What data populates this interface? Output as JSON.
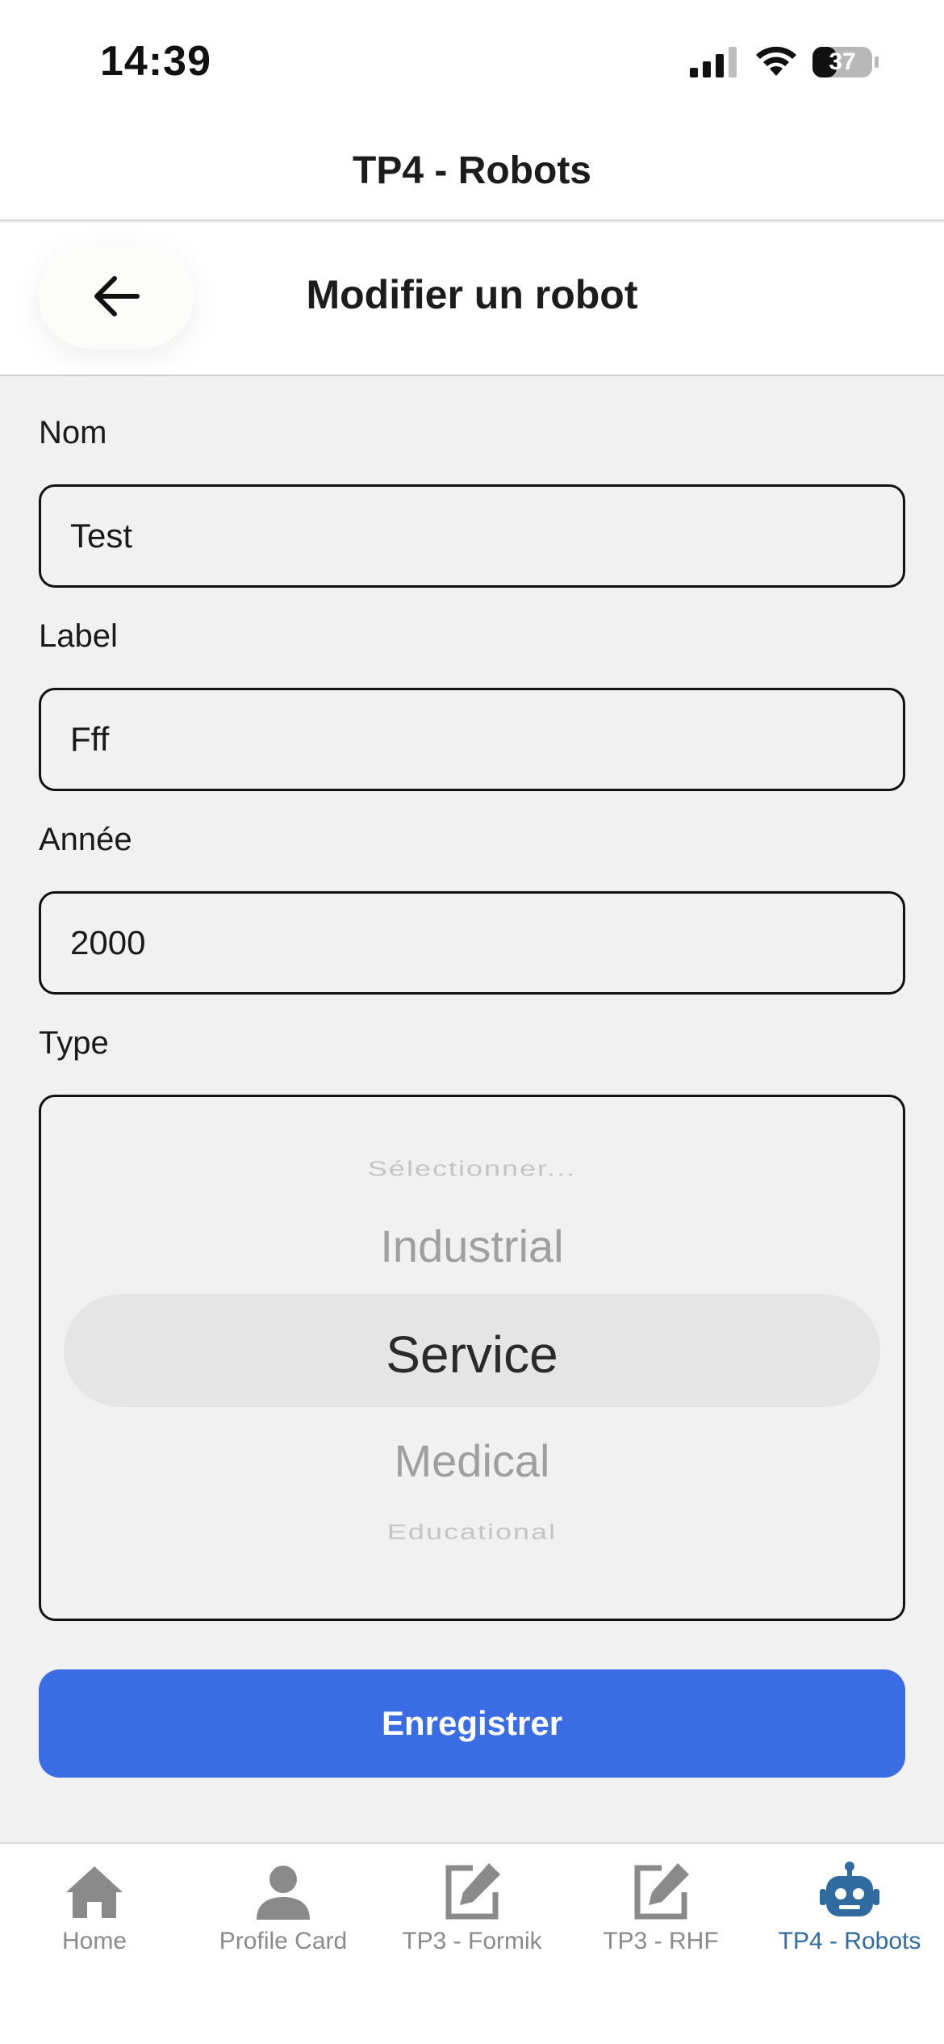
{
  "status_bar": {
    "time": "14:39",
    "battery_level": "37",
    "icons": [
      "cellular-signal-icon",
      "wifi-icon",
      "battery-icon"
    ]
  },
  "app_header": {
    "title": "TP4 - Robots"
  },
  "screen": {
    "title": "Modifier un robot",
    "back_icon": "arrow-left-icon"
  },
  "form": {
    "name": {
      "label": "Nom",
      "value": "Test"
    },
    "label": {
      "label": "Label",
      "value": "Fff"
    },
    "year": {
      "label": "Année",
      "value": "2000"
    },
    "type": {
      "label": "Type",
      "options": [
        "Sélectionner...",
        "Industrial",
        "Service",
        "Medical",
        "Educational"
      ],
      "selected": "Service"
    },
    "save_label": "Enregistrer"
  },
  "tab_bar": {
    "items": [
      {
        "label": "Home",
        "icon": "home-icon",
        "active": false
      },
      {
        "label": "Profile Card",
        "icon": "person-icon",
        "active": false
      },
      {
        "label": "TP3 - Formik",
        "icon": "edit-icon",
        "active": false
      },
      {
        "label": "TP3 - RHF",
        "icon": "edit-icon",
        "active": false
      },
      {
        "label": "TP4 - Robots",
        "icon": "robot-icon",
        "active": true
      }
    ],
    "inactive_color": "#8a8a8a",
    "active_color": "#2f6b9f"
  },
  "colors": {
    "primary_button": "#3a6de3",
    "background": "#f1f1f1"
  }
}
